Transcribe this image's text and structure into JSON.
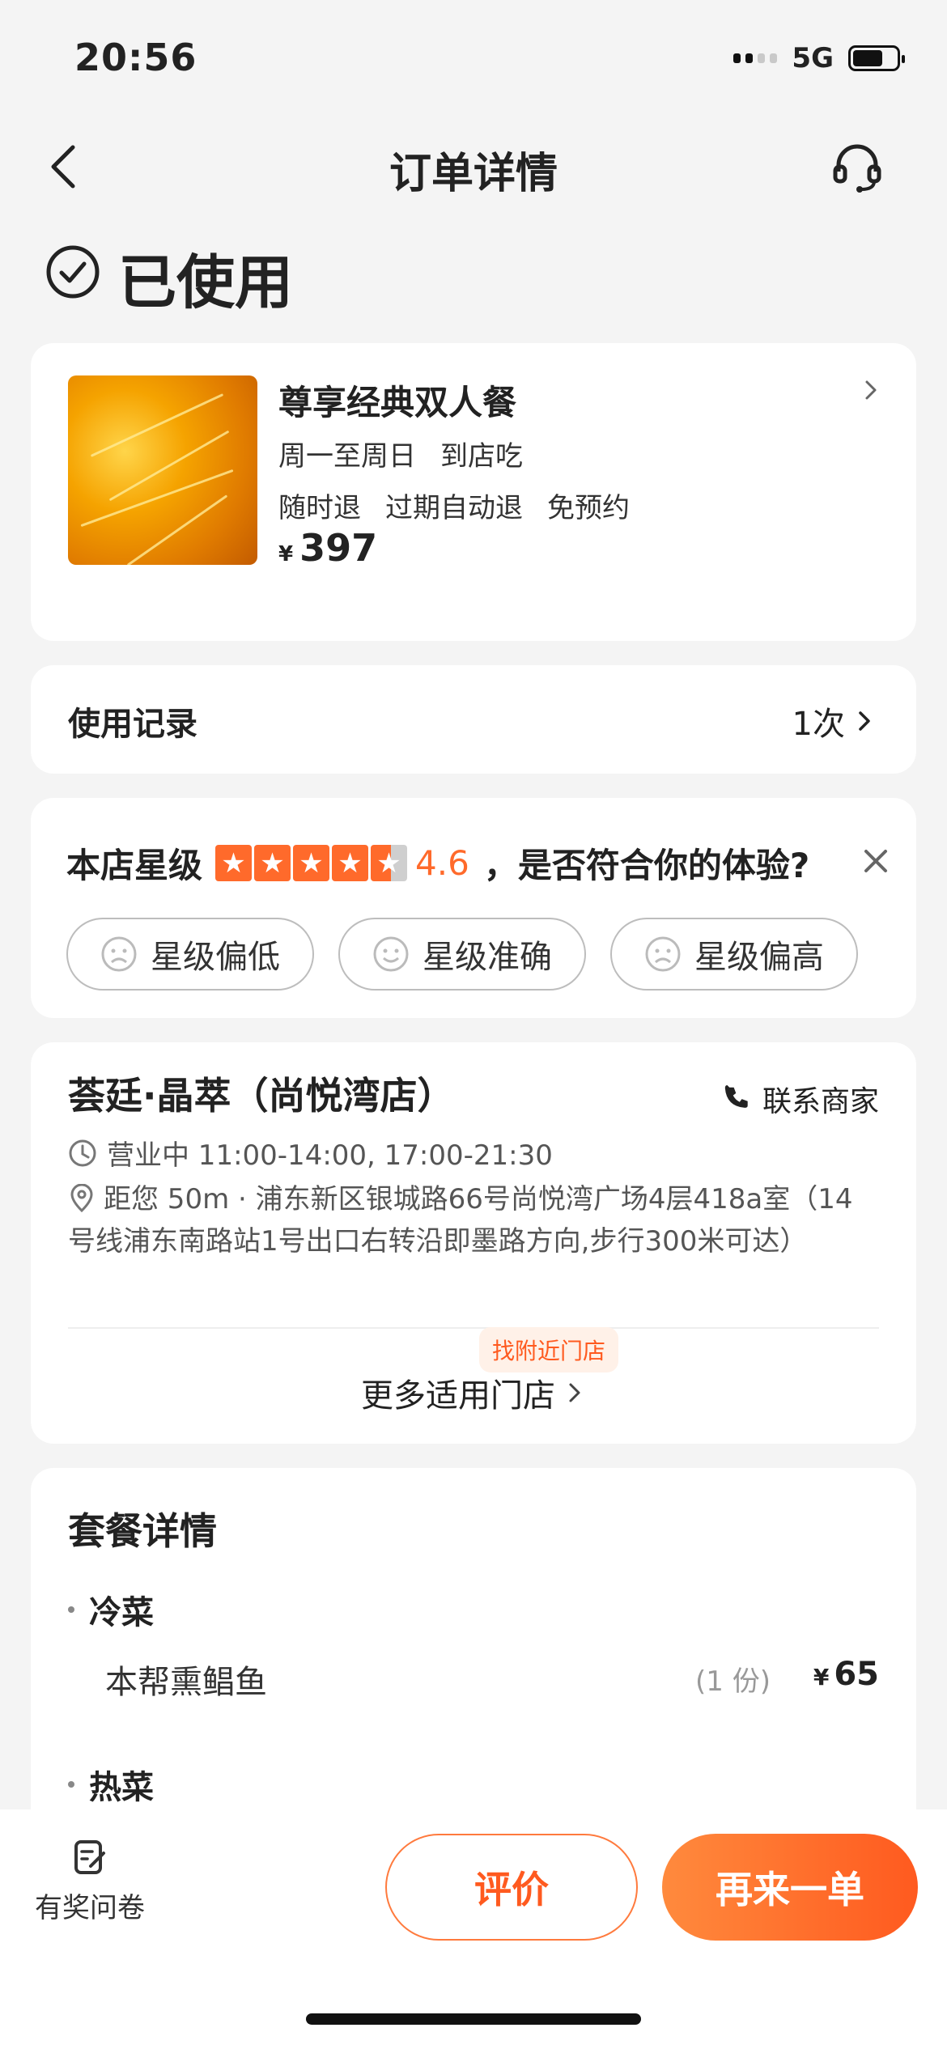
{
  "status_bar": {
    "time": "20:56",
    "network": "5G"
  },
  "nav": {
    "title": "订单详情"
  },
  "order_status": "已使用",
  "product": {
    "title": "尊享经典双人餐",
    "tags_line1": [
      "周一至周日",
      "到店吃"
    ],
    "tags_line2": [
      "随时退",
      "过期自动退",
      "免预约"
    ],
    "currency": "¥",
    "price": "397"
  },
  "usage_record": {
    "label": "使用记录",
    "value": "1次"
  },
  "rating": {
    "label": "本店星级",
    "score": "4.6",
    "question": "，是否符合你的体验?",
    "options": [
      "星级偏低",
      "星级准确",
      "星级偏高"
    ]
  },
  "store": {
    "name": "荟廷·晶萃（尚悦湾店）",
    "contact_label": "联系商家",
    "hours": "营业中 11:00-14:00, 17:00-21:30",
    "address": "距您 50m · 浦东新区银城路66号尚悦湾广场4层418a室（14号线浦东南路站1号出口右转沿即墨路方向,步行300米可达）",
    "nearby_tag": "找附近门店",
    "more_stores": "更多适用门店"
  },
  "package": {
    "title": "套餐详情",
    "cold_category": "冷菜",
    "cold_item": {
      "name": "本帮熏鲳鱼",
      "qty": "(1 份)",
      "currency": "¥",
      "price": "65"
    },
    "hot_category": "热菜"
  },
  "bottom": {
    "survey_label": "有奖问卷",
    "review_label": "评价",
    "reorder_label": "再来一单"
  },
  "colors": {
    "accent": "#ff5a1f",
    "star": "#ff6a2b"
  }
}
